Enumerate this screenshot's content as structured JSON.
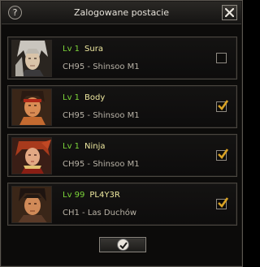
{
  "window": {
    "title": "Zalogowane postacie",
    "help_glyph": "?",
    "help_icon": "question-icon",
    "close_icon": "close-x-icon"
  },
  "characters": [
    {
      "level_prefix": "Lv 1",
      "name": "Sura",
      "server": "CH95 - Shinsoo M1",
      "checked": false,
      "portrait": "sura-portrait-icon"
    },
    {
      "level_prefix": "Lv 1",
      "name": "Body",
      "server": "CH95 - Shinsoo M1",
      "checked": true,
      "portrait": "body-portrait-icon"
    },
    {
      "level_prefix": "Lv 1",
      "name": "Ninja",
      "server": "CH95 - Shinsoo M1",
      "checked": true,
      "portrait": "ninja-portrait-icon"
    },
    {
      "level_prefix": "Lv 99",
      "name": "PL4Y3R",
      "server": "CH1 - Las Duchów",
      "checked": true,
      "portrait": "warrior-portrait-icon"
    }
  ],
  "confirm_icon": "checkmark-icon",
  "colors": {
    "level_green": "#7cd53a",
    "name_yellow": "#efe9a0",
    "check_gold": "#d9a325",
    "frame": "#4a4640"
  }
}
